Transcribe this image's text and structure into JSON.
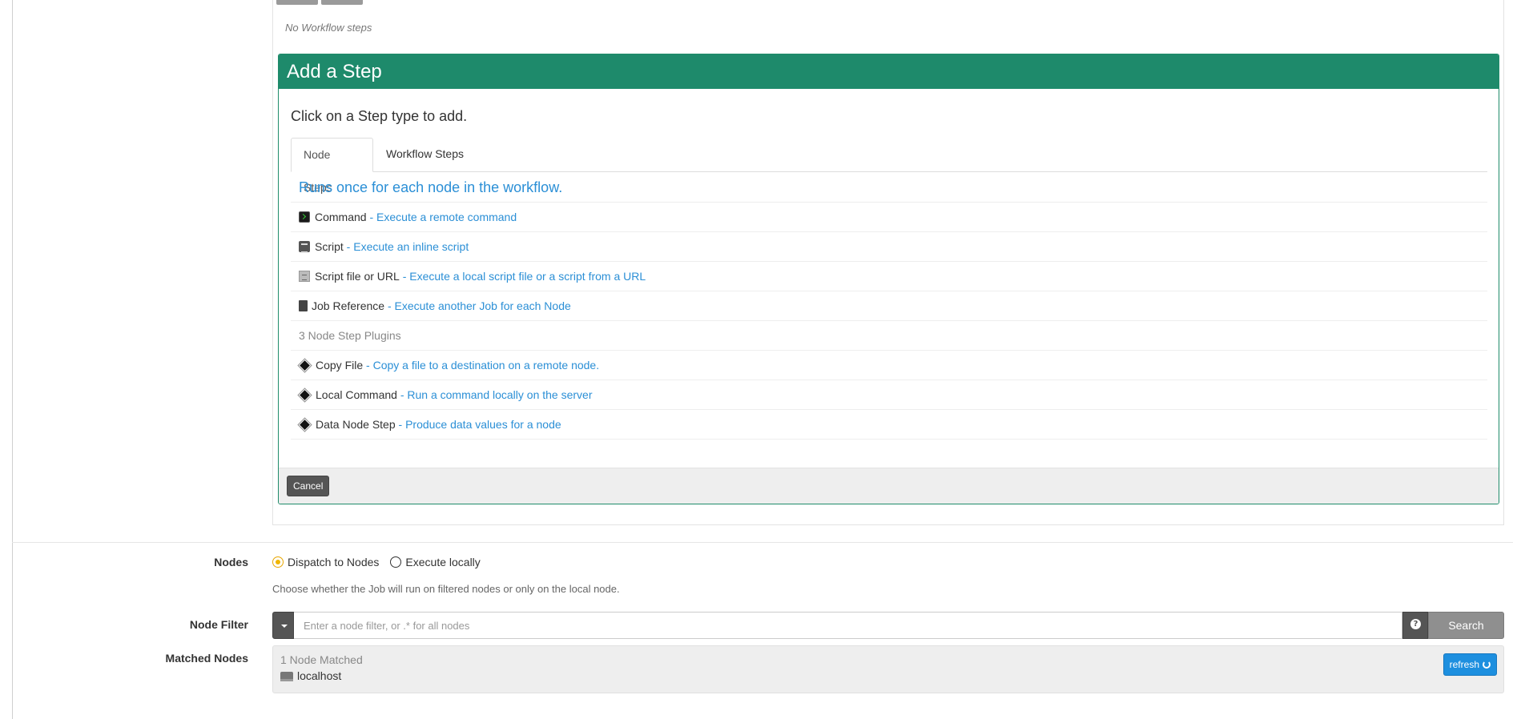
{
  "workflow": {
    "no_steps_text": "No Workflow steps"
  },
  "add_step": {
    "title": "Add a Step",
    "instructions": "Click on a Step type to add.",
    "tabs": [
      {
        "label": "Node Steps",
        "active": true
      },
      {
        "label": "Workflow Steps",
        "active": false
      }
    ],
    "list_heading": "Runs once for each node in the workflow.",
    "steps": [
      {
        "name": "Command",
        "description": "Execute a remote command",
        "icon": "terminal-icon"
      },
      {
        "name": "Script",
        "description": "Execute an inline script",
        "icon": "script-icon"
      },
      {
        "name": "Script file or URL",
        "description": "Execute a local script file or a script from a URL",
        "icon": "script-file-icon"
      },
      {
        "name": "Job Reference",
        "description": "Execute another Job for each Node",
        "icon": "book-icon"
      }
    ],
    "plugin_count_text": "3 Node Step Plugins",
    "plugins": [
      {
        "name": "Copy File",
        "description": "Copy a file to a destination on a remote node.",
        "icon": "plugin-diamond-icon"
      },
      {
        "name": "Local Command",
        "description": "Run a command locally on the server",
        "icon": "plugin-diamond-icon"
      },
      {
        "name": "Data Node Step",
        "description": "Produce data values for a node",
        "icon": "plugin-diamond-icon"
      }
    ],
    "cancel_label": "Cancel"
  },
  "nodes": {
    "label": "Nodes",
    "options": [
      {
        "label": "Dispatch to Nodes",
        "checked": true
      },
      {
        "label": "Execute locally",
        "checked": false
      }
    ],
    "help_text": "Choose whether the Job will run on filtered nodes or only on the local node."
  },
  "node_filter": {
    "label": "Node Filter",
    "value": "",
    "placeholder": "Enter a node filter, or .* for all nodes",
    "search_label": "Search"
  },
  "matched_nodes": {
    "label": "Matched Nodes",
    "count_text": "1 Node Matched",
    "node_name": "localhost",
    "refresh_label": "refresh"
  },
  "colors": {
    "header_green": "#1e8a6b",
    "link_blue": "#2b8fd6",
    "radio_yellow": "#f0b500",
    "refresh_blue": "#1d8fdf"
  }
}
